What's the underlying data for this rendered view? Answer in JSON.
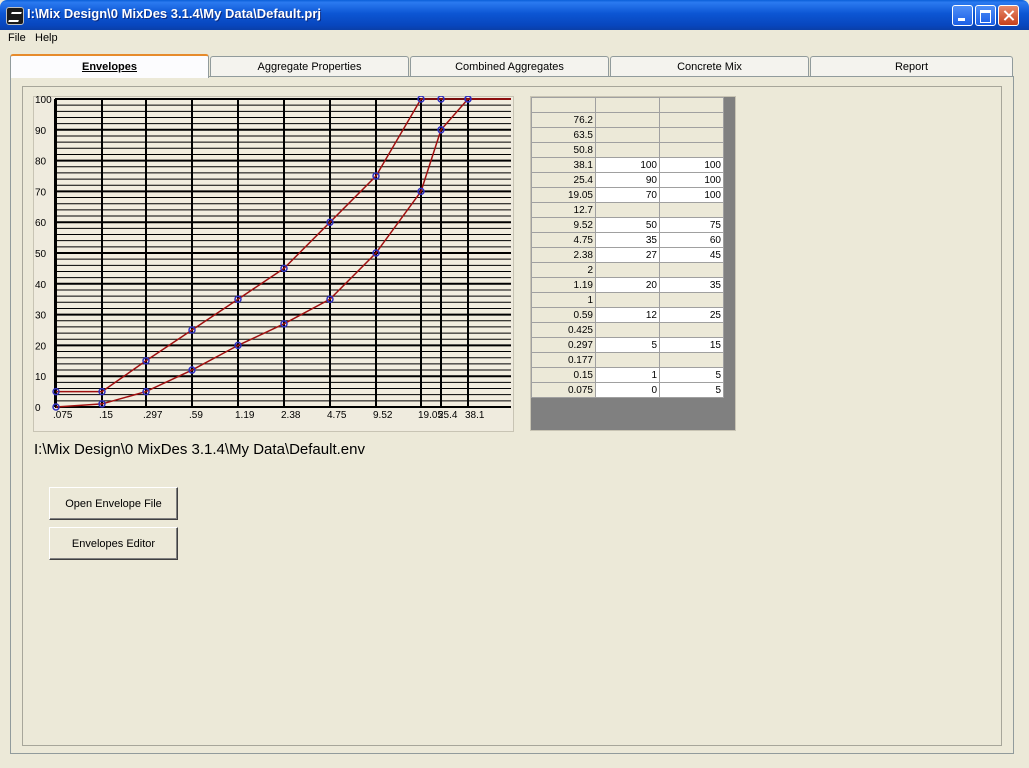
{
  "window": {
    "title": "I:\\Mix Design\\0 MixDes 3.1.4\\My Data\\Default.prj"
  },
  "menu": {
    "items": [
      "File",
      "Help"
    ]
  },
  "tabs": [
    {
      "label": "Envelopes",
      "active": true
    },
    {
      "label": "Aggregate Properties"
    },
    {
      "label": "Combined Aggregates"
    },
    {
      "label": "Concrete Mix"
    },
    {
      "label": "Report"
    }
  ],
  "chart_data": {
    "type": "line",
    "x_tick_labels": [
      ".075",
      ".15",
      ".297",
      ".59",
      "1.19",
      "2.38",
      "4.75",
      "9.52",
      "19.05",
      "25.4",
      "38.1"
    ],
    "y_tick_labels": [
      "0",
      "10",
      "20",
      "30",
      "40",
      "50",
      "60",
      "70",
      "80",
      "90",
      "100"
    ],
    "ylim": [
      0,
      100
    ],
    "grid": true,
    "series": [
      {
        "x": [
          ".075",
          ".15",
          ".297",
          ".59",
          "1.19",
          "2.38",
          "4.75",
          "9.52",
          "19.05",
          "25.4",
          "38.1"
        ],
        "values": [
          5,
          5,
          15,
          25,
          35,
          45,
          60,
          75,
          100,
          100,
          100
        ]
      },
      {
        "x": [
          ".075",
          ".15",
          ".297",
          ".59",
          "1.19",
          "2.38",
          "4.75",
          "9.52",
          "19.05",
          "25.4",
          "38.1"
        ],
        "values": [
          0,
          1,
          5,
          12,
          20,
          27,
          35,
          50,
          70,
          90,
          100
        ]
      }
    ],
    "colors": {
      "line": "#a01010",
      "marker": "#3030c0"
    }
  },
  "envelope_file": "I:\\Mix Design\\0 MixDes 3.1.4\\My Data\\Default.env",
  "buttons": {
    "open_envelope": "Open Envelope File",
    "envelopes_editor": "Envelopes Editor"
  },
  "grid": {
    "rows": [
      [
        "",
        "",
        ""
      ],
      [
        "76.2",
        "",
        ""
      ],
      [
        "63.5",
        "",
        ""
      ],
      [
        "50.8",
        "",
        ""
      ],
      [
        "38.1",
        "100",
        "100"
      ],
      [
        "25.4",
        "90",
        "100"
      ],
      [
        "19.05",
        "70",
        "100"
      ],
      [
        "12.7",
        "",
        ""
      ],
      [
        "9.52",
        "50",
        "75"
      ],
      [
        "4.75",
        "35",
        "60"
      ],
      [
        "2.38",
        "27",
        "45"
      ],
      [
        "2",
        "",
        ""
      ],
      [
        "1.19",
        "20",
        "35"
      ],
      [
        "1",
        "",
        ""
      ],
      [
        "0.59",
        "12",
        "25"
      ],
      [
        "0.425",
        "",
        ""
      ],
      [
        "0.297",
        "5",
        "15"
      ],
      [
        "0.177",
        "",
        ""
      ],
      [
        "0.15",
        "1",
        "5"
      ],
      [
        "0.075",
        "0",
        "5"
      ]
    ]
  }
}
